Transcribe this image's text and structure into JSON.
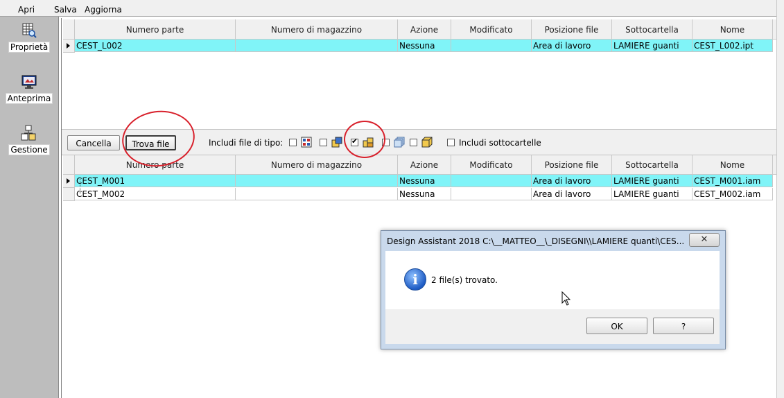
{
  "toolbar": {
    "open_label": "Apri",
    "save_label": "Salva",
    "refresh_label": "Aggiorna"
  },
  "sidebar": {
    "items": [
      {
        "label": "Proprietà",
        "icon": "properties-icon"
      },
      {
        "label": "Anteprima",
        "icon": "preview-icon"
      },
      {
        "label": "Gestione",
        "icon": "manage-icon"
      }
    ]
  },
  "columns": [
    "Numero parte",
    "Numero di magazzino",
    "Azione",
    "Modificato",
    "Posizione file",
    "Sottocartella",
    "Nome"
  ],
  "top_grid": {
    "rows": [
      {
        "part": "CEST_L002",
        "stock": "",
        "action": "Nessuna",
        "modified": "",
        "location": "Area di lavoro",
        "subfolder": "LAMIERE guanti",
        "name": "CEST_L002.ipt"
      }
    ]
  },
  "midbar": {
    "cancel_label": "Cancella",
    "find_label": "Trova file",
    "include_types_label": "Includi file di tipo:",
    "include_subfolders_label": "Includi sottocartelle"
  },
  "bottom_grid": {
    "rows": [
      {
        "part": "CEST_M001",
        "stock": "",
        "action": "Nessuna",
        "modified": "",
        "location": "Area di lavoro",
        "subfolder": "LAMIERE guanti",
        "name": "CEST_M001.iam"
      },
      {
        "part": "CEST_M002",
        "stock": "",
        "action": "Nessuna",
        "modified": "",
        "location": "Area di lavoro",
        "subfolder": "LAMIERE guanti",
        "name": "CEST_M002.iam"
      }
    ]
  },
  "dialog": {
    "title": "Design Assistant 2018 C:\\__MATTEO__\\_DISEGNI\\\\LAMIERE quanti\\CES...",
    "close_label": "✕",
    "message": "2 file(s) trovato.",
    "ok_label": "OK",
    "help_label": "?"
  },
  "colors": {
    "selected_row": "#80f4f8",
    "annotation": "#d8202b"
  }
}
